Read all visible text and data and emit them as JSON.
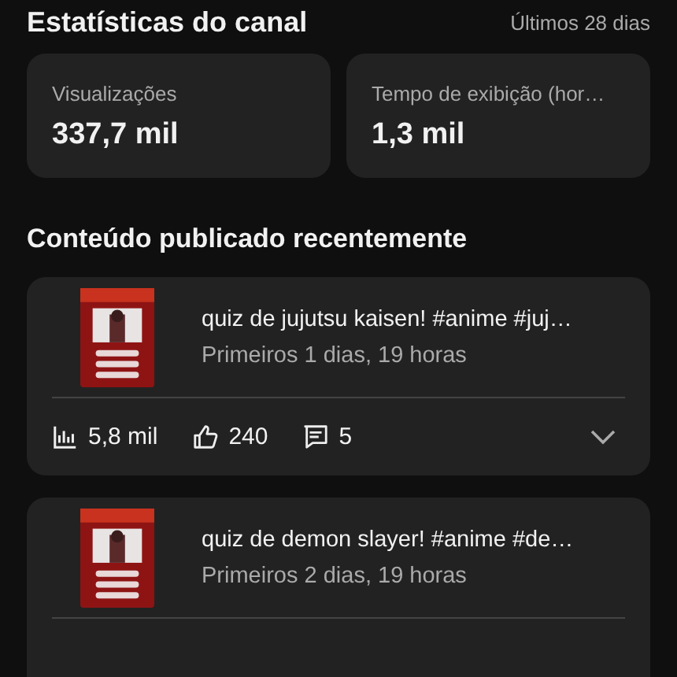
{
  "header": {
    "title": "Estatísticas do canal",
    "period": "Últimos 28 dias"
  },
  "stats": [
    {
      "label": "Visualizações",
      "value": "337,7 mil"
    },
    {
      "label": "Tempo de exibição (hor…",
      "value": "1,3 mil"
    }
  ],
  "section_title": "Conteúdo publicado recentemente",
  "videos": [
    {
      "title": "quiz de jujutsu kaisen! #anime #juj…",
      "subtitle": "Primeiros 1 dias, 19 horas",
      "views": "5,8 mil",
      "likes": "240",
      "comments": "5"
    },
    {
      "title": "quiz de demon slayer! #anime #de…",
      "subtitle": "Primeiros 2 dias, 19 horas"
    }
  ]
}
